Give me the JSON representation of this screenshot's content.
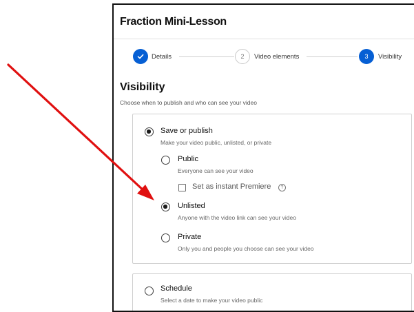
{
  "dialog": {
    "title": "Fraction Mini-Lesson"
  },
  "stepper": {
    "steps": [
      {
        "label": "Details",
        "number": "",
        "state": "done",
        "icon": "check-icon"
      },
      {
        "label": "Video elements",
        "number": "2",
        "state": "todo"
      },
      {
        "label": "Visibility",
        "number": "3",
        "state": "active"
      }
    ]
  },
  "visibility": {
    "title": "Visibility",
    "subtitle": "Choose when to publish and who can see your video",
    "save_or_publish": {
      "label": "Save or publish",
      "description": "Make your video public, unlisted, or private",
      "selected": true
    },
    "options": [
      {
        "label": "Public",
        "description": "Everyone can see your video",
        "selected": false
      },
      {
        "label": "Unlisted",
        "description": "Anyone with the video link can see your video",
        "selected": true
      },
      {
        "label": "Private",
        "description": "Only you and people you choose can see your video",
        "selected": false
      }
    ],
    "instant_premiere": {
      "label": "Set as instant Premiere",
      "checked": false,
      "help_icon": "help-circle-icon",
      "help_glyph": "?"
    },
    "schedule": {
      "label": "Schedule",
      "description": "Select a date to make your video public",
      "selected": false
    }
  },
  "colors": {
    "accent_blue": "#065fd4",
    "annotation_arrow": "#e01010"
  }
}
